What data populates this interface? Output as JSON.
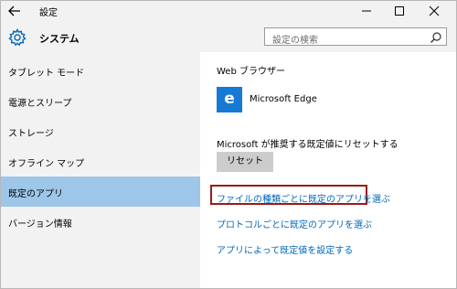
{
  "window": {
    "title": "設定"
  },
  "header": {
    "title": "システム",
    "search_placeholder": "設定の検索"
  },
  "sidebar": {
    "items": [
      {
        "label": "タブレット モード",
        "selected": false
      },
      {
        "label": "電源とスリープ",
        "selected": false
      },
      {
        "label": "ストレージ",
        "selected": false
      },
      {
        "label": "オフライン マップ",
        "selected": false
      },
      {
        "label": "既定のアプリ",
        "selected": true
      },
      {
        "label": "バージョン情報",
        "selected": false
      }
    ]
  },
  "content": {
    "web_browser_heading": "Web ブラウザー",
    "web_browser_app": "Microsoft Edge",
    "app_tile_glyph": "e",
    "reset_description": "Microsoft が推奨する既定値にリセットする",
    "reset_button": "リセット",
    "links": [
      "ファイルの種類ごとに既定のアプリを選ぶ",
      "プロトコルごとに既定のアプリを選ぶ",
      "アプリによって既定値を設定する"
    ]
  },
  "colors": {
    "accent": "#0067b8",
    "selected_bg": "#9ec6e8",
    "app_tile": "#1679d4",
    "highlight_border": "#9b1a1a"
  }
}
